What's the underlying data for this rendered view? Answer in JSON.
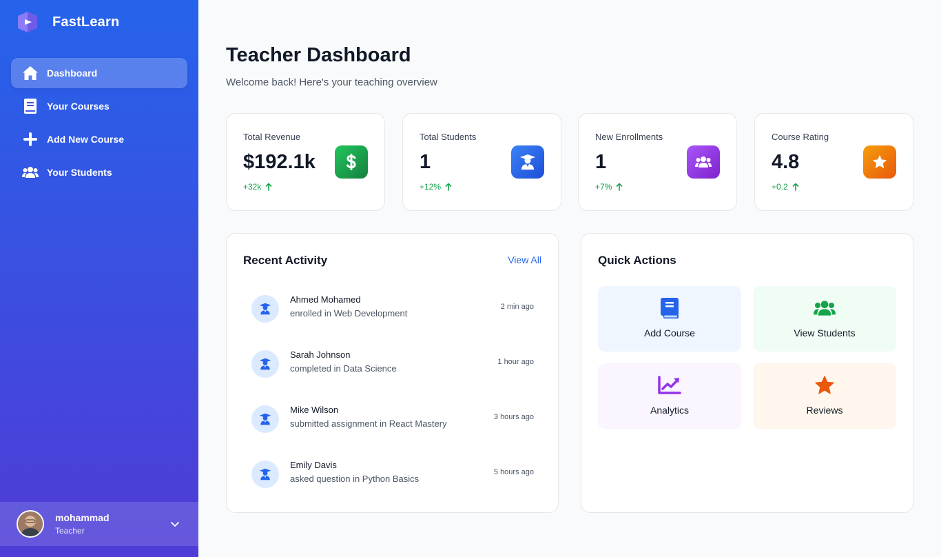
{
  "app": {
    "name": "FastLearn"
  },
  "sidebar": {
    "items": [
      {
        "label": "Dashboard",
        "icon": "home-icon",
        "active": true
      },
      {
        "label": "Your Courses",
        "icon": "book-icon",
        "active": false
      },
      {
        "label": "Add New Course",
        "icon": "plus-icon",
        "active": false
      },
      {
        "label": "Your Students",
        "icon": "users-icon",
        "active": false
      }
    ],
    "user": {
      "name": "mohammad",
      "role": "Teacher"
    }
  },
  "header": {
    "title": "Teacher Dashboard",
    "subtitle": "Welcome back! Here's your teaching overview"
  },
  "stats": [
    {
      "label": "Total Revenue",
      "value": "$192.1k",
      "change": "+32k",
      "icon": "dollar-icon",
      "color": "#16a34a"
    },
    {
      "label": "Total Students",
      "value": "1",
      "change": "+12%",
      "icon": "graduate-icon",
      "color": "#2563eb"
    },
    {
      "label": "New Enrollments",
      "value": "1",
      "change": "+7%",
      "icon": "users-icon",
      "color": "#9333ea"
    },
    {
      "label": "Course Rating",
      "value": "4.8",
      "change": "+0.2",
      "icon": "star-icon",
      "color": "#f59e0b"
    }
  ],
  "activity": {
    "title": "Recent Activity",
    "view_all": "View All",
    "items": [
      {
        "name": "Ahmed Mohamed",
        "desc": "enrolled in Web Development",
        "time": "2 min ago"
      },
      {
        "name": "Sarah Johnson",
        "desc": "completed in Data Science",
        "time": "1 hour ago"
      },
      {
        "name": "Mike Wilson",
        "desc": "submitted assignment in React Mastery",
        "time": "3 hours ago"
      },
      {
        "name": "Emily Davis",
        "desc": "asked question in Python Basics",
        "time": "5 hours ago"
      }
    ]
  },
  "quick_actions": {
    "title": "Quick Actions",
    "items": [
      {
        "label": "Add Course",
        "icon": "book-icon",
        "bg": "#eff6ff",
        "color": "#2563eb"
      },
      {
        "label": "View Students",
        "icon": "users-icon",
        "bg": "#f0fdf4",
        "color": "#16a34a"
      },
      {
        "label": "Analytics",
        "icon": "chart-line-icon",
        "bg": "#faf5ff",
        "color": "#9333ea"
      },
      {
        "label": "Reviews",
        "icon": "star-icon",
        "bg": "#fff7ed",
        "color": "#ea580c"
      }
    ]
  }
}
